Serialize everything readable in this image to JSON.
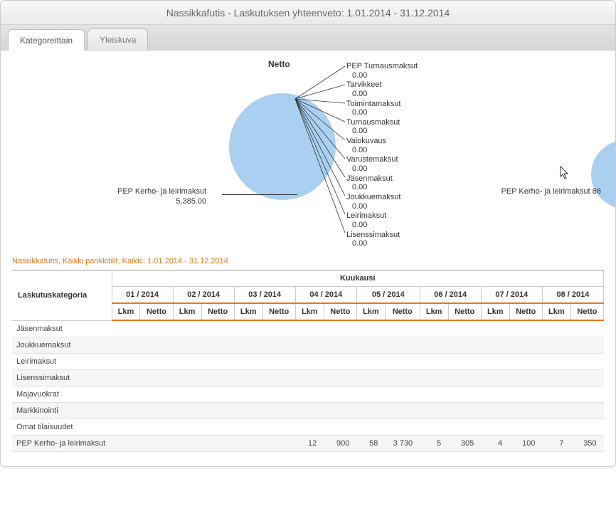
{
  "window_title": "Nassikkafutis - Laskutuksen yhteenveto: 1.01.2014 - 31.12.2014",
  "tabs": {
    "active": "Kategoreittain",
    "inactive": "Yleiskuva"
  },
  "chart_data": {
    "type": "pie",
    "title": "Netto",
    "series": [
      {
        "name": "PEP Kerho- ja leirimaksut",
        "value": 5385.0
      },
      {
        "name": "PEP Turnausmaksut",
        "value": 0.0
      },
      {
        "name": "Tarvikkeet",
        "value": 0.0
      },
      {
        "name": "Toimintamaksut",
        "value": 0.0
      },
      {
        "name": "Turnausmaksut",
        "value": 0.0
      },
      {
        "name": "Valokuvaus",
        "value": 0.0
      },
      {
        "name": "Varustemaksut",
        "value": 0.0
      },
      {
        "name": "Jäsenmaksut",
        "value": 0.0
      },
      {
        "name": "Joukkuemaksut",
        "value": 0.0
      },
      {
        "name": "Leirimaksut",
        "value": 0.0
      },
      {
        "name": "Lisenssimaksut",
        "value": 0.0
      }
    ],
    "secondary_label": {
      "name": "PEP Kerho- ja leirimaksut",
      "value": 86
    }
  },
  "subtitle": "Nassikkafutis, Kaikki pankkitilit, Kaikki: 1.01.2014 - 31.12.2014",
  "table": {
    "group_header": "Kuukausi",
    "cat_header": "Laskutuskategoria",
    "months": [
      "01 / 2014",
      "02 / 2014",
      "03 / 2014",
      "04 / 2014",
      "05 / 2014",
      "06 / 2014",
      "07 / 2014",
      "08 / 2014"
    ],
    "sub_headers": [
      "Lkm",
      "Netto"
    ],
    "rows": [
      {
        "cat": "Jäsenmaksut",
        "cells": [
          "",
          "",
          "",
          "",
          "",
          "",
          "",
          "",
          "",
          "",
          "",
          "",
          "",
          "",
          "",
          ""
        ]
      },
      {
        "cat": "Joukkuemaksut",
        "cells": [
          "",
          "",
          "",
          "",
          "",
          "",
          "",
          "",
          "",
          "",
          "",
          "",
          "",
          "",
          "",
          ""
        ]
      },
      {
        "cat": "Leirimaksut",
        "cells": [
          "",
          "",
          "",
          "",
          "",
          "",
          "",
          "",
          "",
          "",
          "",
          "",
          "",
          "",
          "",
          ""
        ]
      },
      {
        "cat": "Lisenssimaksut",
        "cells": [
          "",
          "",
          "",
          "",
          "",
          "",
          "",
          "",
          "",
          "",
          "",
          "",
          "",
          "",
          "",
          ""
        ]
      },
      {
        "cat": "Majavuokrat",
        "cells": [
          "",
          "",
          "",
          "",
          "",
          "",
          "",
          "",
          "",
          "",
          "",
          "",
          "",
          "",
          "",
          ""
        ]
      },
      {
        "cat": "Markkinointi",
        "cells": [
          "",
          "",
          "",
          "",
          "",
          "",
          "",
          "",
          "",
          "",
          "",
          "",
          "",
          "",
          "",
          ""
        ]
      },
      {
        "cat": "Omat tilaisuudet",
        "cells": [
          "",
          "",
          "",
          "",
          "",
          "",
          "",
          "",
          "",
          "",
          "",
          "",
          "",
          "",
          "",
          ""
        ]
      },
      {
        "cat": "PEP Kerho- ja leirimaksut",
        "cells": [
          "",
          "",
          "",
          "",
          "",
          "",
          "12",
          "900",
          "58",
          "3 730",
          "5",
          "305",
          "4",
          "100",
          "7",
          "350"
        ]
      }
    ]
  }
}
